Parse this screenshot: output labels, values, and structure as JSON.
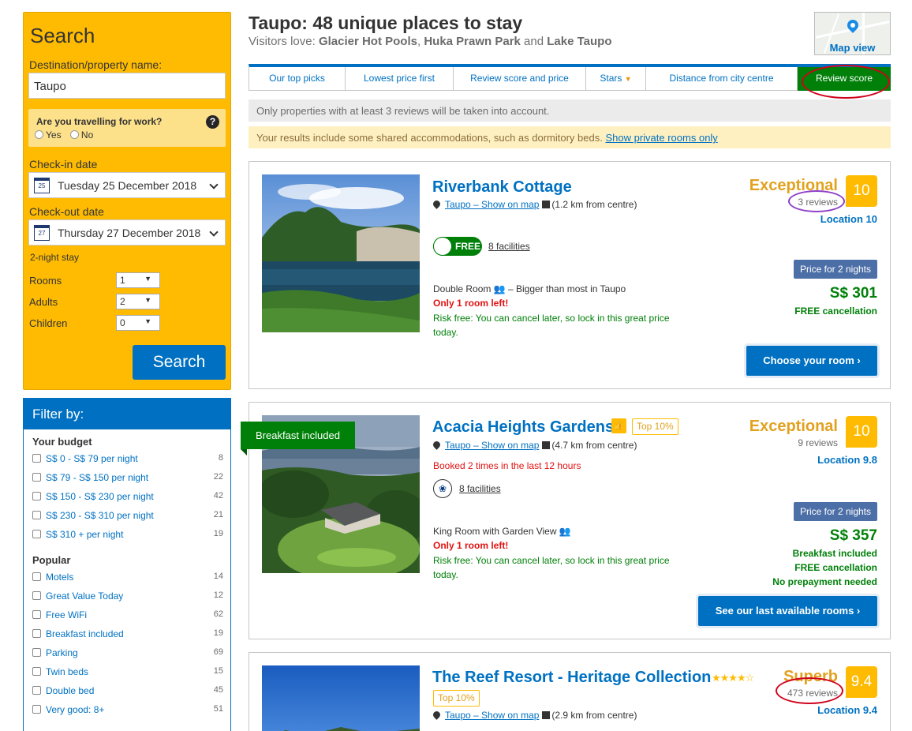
{
  "search": {
    "title": "Search",
    "dest_label": "Destination/property name:",
    "dest_value": "Taupo",
    "work_question": "Are you travelling for work?",
    "work_yes": "Yes",
    "work_no": "No",
    "checkin_label": "Check-in date",
    "checkin_value": "Tuesday 25 December 2018",
    "checkin_day": "25",
    "checkout_label": "Check-out date",
    "checkout_value": "Thursday 27 December 2018",
    "checkout_day": "27",
    "stay_length": "2-night stay",
    "rooms_label": "Rooms",
    "rooms_value": "1",
    "adults_label": "Adults",
    "adults_value": "2",
    "children_label": "Children",
    "children_value": "0",
    "button": "Search"
  },
  "filter": {
    "title": "Filter by:",
    "budget_title": "Your budget",
    "budget": [
      {
        "label": "S$ 0 - S$ 79 per night",
        "count": "8"
      },
      {
        "label": "S$ 79 - S$ 150 per night",
        "count": "22"
      },
      {
        "label": "S$ 150 - S$ 230 per night",
        "count": "42"
      },
      {
        "label": "S$ 230 - S$ 310 per night",
        "count": "21"
      },
      {
        "label": "S$ 310 + per night",
        "count": "19"
      }
    ],
    "popular_title": "Popular",
    "popular": [
      {
        "label": "Motels",
        "count": "14"
      },
      {
        "label": "Great Value Today",
        "count": "12"
      },
      {
        "label": "Free WiFi",
        "count": "62"
      },
      {
        "label": "Breakfast included",
        "count": "19"
      },
      {
        "label": "Parking",
        "count": "69"
      },
      {
        "label": "Twin beds",
        "count": "15"
      },
      {
        "label": "Double bed",
        "count": "45"
      },
      {
        "label": "Very good: 8+",
        "count": "51"
      }
    ]
  },
  "header": {
    "title": "Taupo: 48 unique places to stay",
    "subtitle_prefix": "Visitors love: ",
    "attraction1": "Glacier Hot Pools",
    "sep1": ", ",
    "attraction2": "Huka Prawn Park",
    "sep2": " and ",
    "attraction3": "Lake Taupo",
    "map_view": "Map view"
  },
  "sort": {
    "tabs": [
      "Our top picks",
      "Lowest price first",
      "Review score and price",
      "Stars",
      "Distance from city centre",
      "Review score"
    ],
    "active_index": 5
  },
  "notices": {
    "reviews_notice": "Only properties with at least 3 reviews will be taken into account.",
    "shared_notice": "Your results include some shared accommodations, such as dormitory beds. ",
    "shared_link": "Show private rooms only"
  },
  "properties": [
    {
      "name": "Riverbank Cottage",
      "location_link": "Taupo – Show on map",
      "distance": "(1.2 km from centre)",
      "free_badge": "FREE",
      "facilities": "8 facilities",
      "room": "Double Room",
      "room_note": " – Bigger than most in Taupo",
      "availability": "Only 1 room left!",
      "risk_free": "Risk free: You can cancel later, so lock in this great price today.",
      "score_word": "Exceptional",
      "score": "10",
      "reviews": "3 reviews",
      "location_score": "Location 10",
      "price_label": "Price for 2 nights",
      "price": "S$ 301",
      "perks": [
        "FREE cancellation"
      ],
      "cta": "Choose your room"
    },
    {
      "name": "Acacia Heights Gardens",
      "badge": "Top 10%",
      "ribbon": "Breakfast included",
      "location_link": "Taupo – Show on map",
      "distance": "(4.7 km from centre)",
      "booked": "Booked 2 times in the last 12 hours",
      "facilities": "8 facilities",
      "room": "King Room with Garden View",
      "availability": "Only 1 room left!",
      "risk_free": "Risk free: You can cancel later, so lock in this great price today.",
      "score_word": "Exceptional",
      "score": "10",
      "reviews": "9 reviews",
      "location_score": "Location 9.8",
      "price_label": "Price for 2 nights",
      "price": "S$ 357",
      "perks": [
        "Breakfast included",
        "FREE cancellation",
        "No prepayment needed"
      ],
      "cta": "See our last available rooms"
    },
    {
      "name": "The Reef Resort - Heritage Collection",
      "stars": "★★★★☆",
      "badge": "Top 10%",
      "location_link": "Taupo – Show on map",
      "distance": "(2.9 km from centre)",
      "score_word": "Superb",
      "score": "9.4",
      "reviews": "473 reviews",
      "location_score": "Location 9.4"
    }
  ],
  "colors": {
    "brand_blue": "#0071c2",
    "search_yellow": "#febb02",
    "green": "#008009",
    "annotation_red": "#d0021b",
    "annotation_purple": "#8e3ec8"
  }
}
